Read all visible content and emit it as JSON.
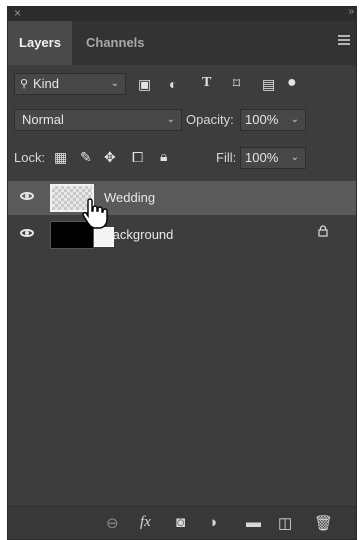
{
  "window": {
    "close_glyph": "×",
    "collapse_glyph": "»"
  },
  "tabs": [
    {
      "label": "Layers"
    },
    {
      "label": "Channels"
    }
  ],
  "filter": {
    "value": "Kind"
  },
  "blend": {
    "mode": "Normal",
    "opacity_label": "Opacity:",
    "opacity_value": "100%"
  },
  "lock": {
    "label": "Lock:",
    "fill_label": "Fill:",
    "fill_value": "100%"
  },
  "layers": [
    {
      "name": "Wedding",
      "selected": true
    },
    {
      "name": "Background",
      "locked": true
    }
  ],
  "icons": {
    "filter_icons": [
      "image-filter-icon",
      "adjustment-filter-icon",
      "type-filter-icon",
      "shape-filter-icon",
      "smart-object-filter-icon",
      "toggle-filter-icon"
    ],
    "lock_icons": [
      "lock-transparent-icon",
      "lock-image-icon",
      "lock-position-icon",
      "lock-artboard-icon",
      "lock-all-icon"
    ],
    "bottom_icons": [
      "link-layers-icon",
      "fx-icon",
      "mask-icon",
      "adjustment-layer-icon",
      "group-folder-icon",
      "new-layer-icon",
      "trash-icon"
    ]
  },
  "colors": {
    "panel": "#3d3d3d",
    "selected_row": "#5a5a5a"
  }
}
